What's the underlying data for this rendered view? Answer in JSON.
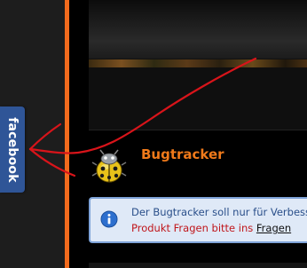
{
  "sidebar": {
    "facebook_tab_label": "facebook"
  },
  "section": {
    "title": "Bugtracker",
    "icon": "ladybug-icon"
  },
  "notice": {
    "icon": "info-icon",
    "line1": "Der Bugtracker soll nur für Verbess",
    "line2_prefix": "Produkt Fragen bitte ins ",
    "line2_link": "Fragen"
  },
  "colors": {
    "accent_orange": "#f26b1d",
    "facebook_blue": "#2f5597",
    "title_orange": "#f07a1a",
    "notice_bg": "#dfe9f7",
    "notice_border": "#7ea3d8",
    "notice_red": "#c0161b",
    "annotation_red": "#d8141a"
  }
}
